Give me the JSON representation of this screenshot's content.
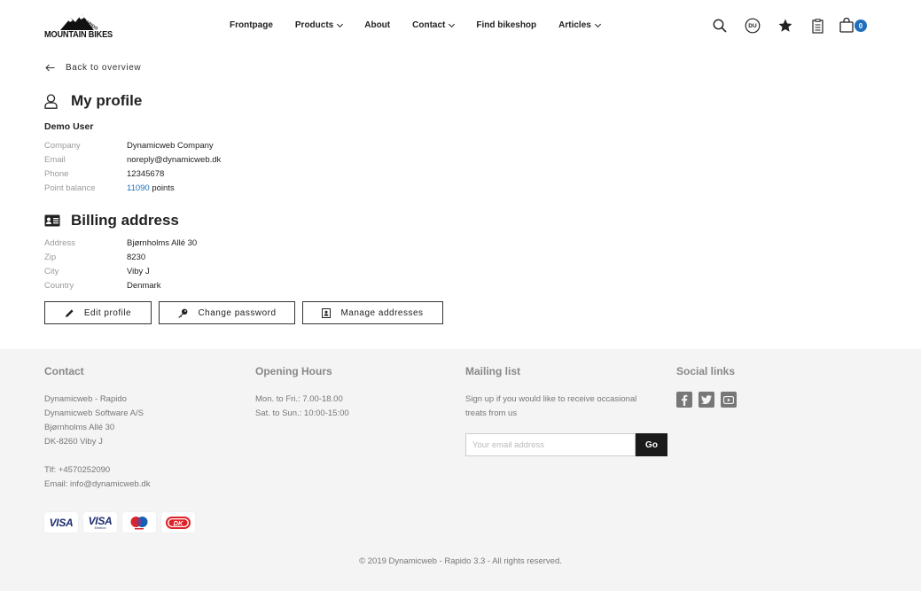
{
  "header": {
    "logo_text": "MOUNTAIN BIKES",
    "logo_small": "RAPIDO",
    "nav": [
      {
        "label": "Frontpage",
        "has_dropdown": false
      },
      {
        "label": "Products",
        "has_dropdown": true
      },
      {
        "label": "About",
        "has_dropdown": false
      },
      {
        "label": "Contact",
        "has_dropdown": true
      },
      {
        "label": "Find bikeshop",
        "has_dropdown": false
      },
      {
        "label": "Articles",
        "has_dropdown": true
      }
    ],
    "tools": {
      "search_icon": "search-icon",
      "language_code": "DU",
      "favorites_icon": "star-icon",
      "orders_icon": "clipboard-icon",
      "cart_icon": "shopping-bag-icon",
      "cart_count": "0"
    },
    "accent": "#1f6fbf"
  },
  "main": {
    "back_label": "Back to overview",
    "profile_title": "My profile",
    "user_name": "Demo User",
    "profile_fields": [
      {
        "label": "Company",
        "value": "Dynamicweb Company"
      },
      {
        "label": "Email",
        "value": "noreply@dynamicweb.dk"
      },
      {
        "label": "Phone",
        "value": "12345678"
      }
    ],
    "point_balance": {
      "label": "Point balance",
      "value": "11090",
      "unit": "points"
    },
    "billing_title": "Billing address",
    "billing_fields": [
      {
        "label": "Address",
        "value": "Bjørnholms Allé 30"
      },
      {
        "label": "Zip",
        "value": "8230"
      },
      {
        "label": "City",
        "value": "Viby J"
      },
      {
        "label": "Country",
        "value": "Denmark"
      }
    ],
    "buttons": {
      "edit_profile": "Edit profile",
      "change_password": "Change password",
      "manage_addresses": "Manage addresses"
    }
  },
  "footer": {
    "contact": {
      "title": "Contact",
      "lines": [
        "Dynamicweb - Rapido",
        "Dynamicweb Software A/S",
        "Bjørnholms Allé 30",
        "DK-8260 Viby J"
      ],
      "phone": "Tlf: +4570252090",
      "email": "Email: info@dynamicweb.dk"
    },
    "hours": {
      "title": "Opening Hours",
      "lines": [
        "Mon. to Fri.: 7.00-18.00",
        "Sat. to Sun.: 10:00-15:00"
      ]
    },
    "mailing": {
      "title": "Mailing list",
      "lines": [
        "Sign up if you would like to receive occasional",
        "treats from us"
      ],
      "placeholder": "Your email address",
      "button": "Go"
    },
    "social": {
      "title": "Social links",
      "icons": [
        "facebook-icon",
        "twitter-icon",
        "youtube-icon"
      ]
    },
    "payment_cards": {
      "visa": "VISA",
      "visa_electron": "VISA",
      "visa_electron_sub": "Electron",
      "maestro_icon": "maestro-icon",
      "dankort": "DK"
    },
    "copyright": "© 2019 Dynamicweb - Rapido 3.3 - All rights reserved."
  }
}
